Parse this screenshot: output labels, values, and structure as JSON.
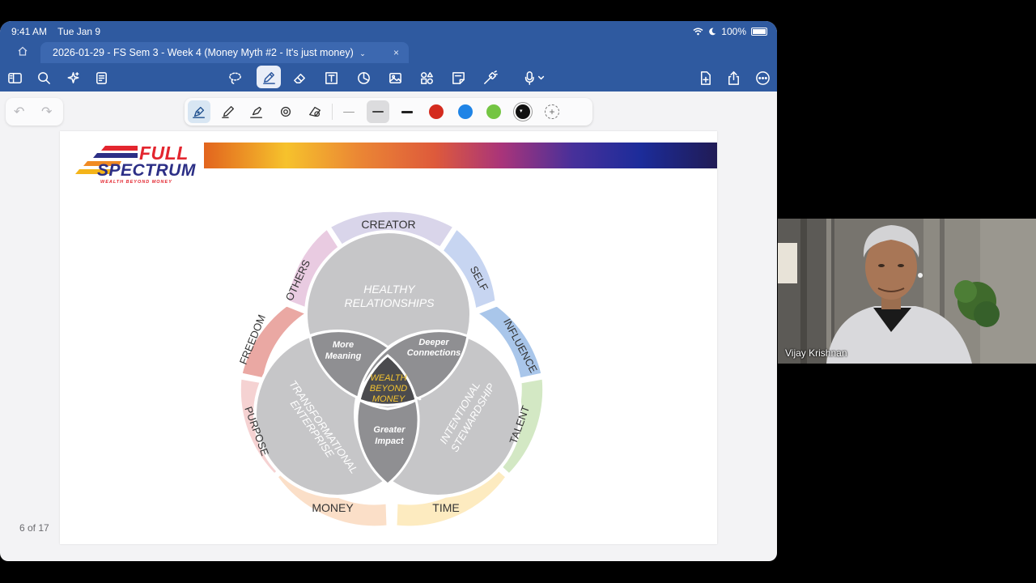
{
  "status": {
    "time": "9:41 AM",
    "date": "Tue Jan 9",
    "battery": "100%"
  },
  "tab": {
    "title": "2026-01-29 - FS Sem 3 - Week 4 (Money Myth #2 - It's just money)",
    "caret": "⌄",
    "close": "×"
  },
  "icons": {
    "home": "home-icon",
    "sidebar": "sidebar-icon",
    "search": "search-icon",
    "magic": "sparkle-icon",
    "notes": "notes-icon",
    "lasso": "lasso-icon",
    "pen": "pen-icon",
    "eraser": "eraser-icon",
    "text": "textbox-icon",
    "shapes": "shapes-icon",
    "image": "image-icon",
    "elements": "elements-icon",
    "sticky": "sticky-note-icon",
    "laser": "laser-pointer-icon",
    "mic": "microphone-icon",
    "add-page": "add-page-icon",
    "share": "share-icon",
    "more": "more-icon"
  },
  "undo_redo": {
    "undo": "↶",
    "redo": "↷"
  },
  "palette": {
    "colors": [
      "#d42b1e",
      "#1f84e6",
      "#74c543",
      "#111111"
    ],
    "add": "+"
  },
  "slide": {
    "logo_full": "FULL",
    "logo_spectrum": "SPECTRUM",
    "logo_tagline": "WEALTH BEYOND MONEY",
    "outer_labels": {
      "creator": "CREATOR",
      "self": "SELF",
      "influence": "INFLUENCE",
      "talent": "TALENT",
      "time": "TIME",
      "money": "MONEY",
      "purpose": "PURPOSE",
      "freedom": "FREEDOM",
      "others": "OTHERS"
    },
    "circles": {
      "top_line1": "HEALTHY",
      "top_line2": "RELATIONSHIPS",
      "left_line1": "TRANSFORMATIONAL",
      "left_line2": "ENTERPRISE",
      "right_line1": "INTENTIONAL",
      "right_line2": "STEWARDSHIP"
    },
    "overlaps": {
      "more_line1": "More",
      "more_line2": "Meaning",
      "deeper_line1": "Deeper",
      "deeper_line2": "Connections",
      "greater_line1": "Greater",
      "greater_line2": "Impact",
      "center_line1": "WEALTH",
      "center_line2": "BEYOND",
      "center_line3": "MONEY"
    }
  },
  "page_indicator": "6 of 17",
  "video": {
    "participant": "Vijay Krishnan"
  }
}
